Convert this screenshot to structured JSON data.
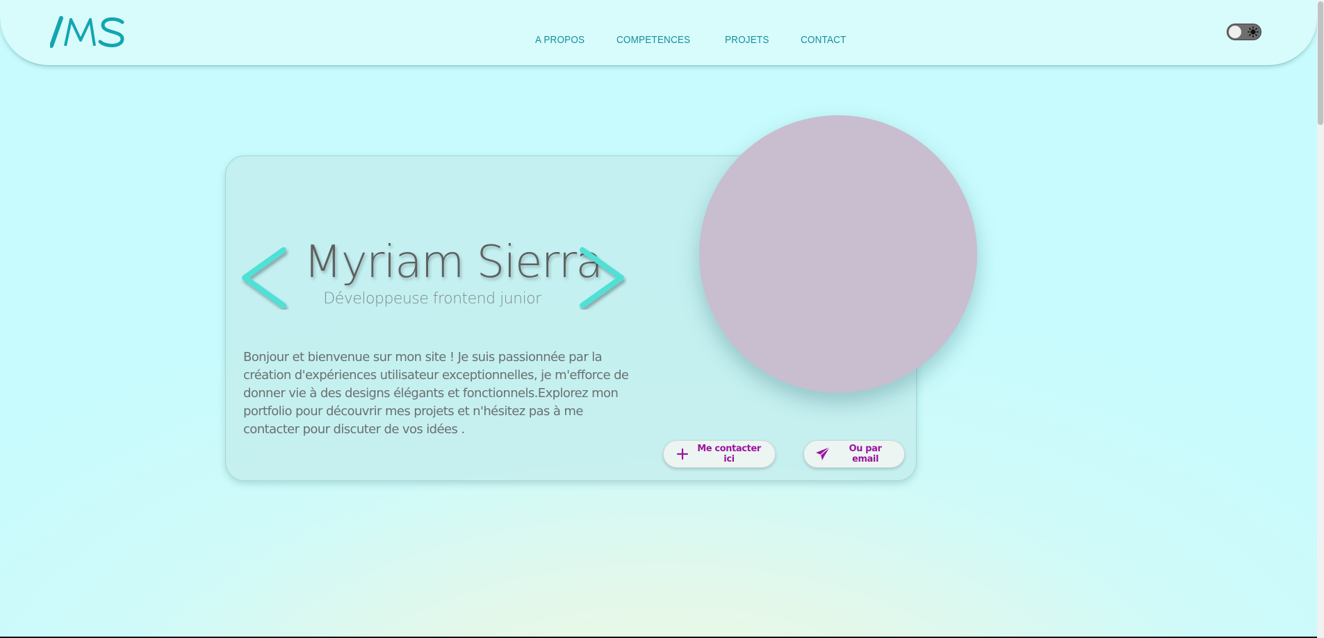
{
  "header": {
    "logo_text": "/MS",
    "nav": [
      "A PROPOS",
      "COMPETENCES",
      "PROJETS",
      "CONTACT"
    ],
    "theme_toggle": {
      "state": "off",
      "icon": "sun-icon"
    }
  },
  "hero": {
    "name": "Myriam Sierra",
    "role": "Développeuse frontend junior",
    "intro": "Bonjour et bienvenue sur mon site ! Je suis passionnée par la création d'expériences utilisateur exceptionnelles, je m'efforce de donner vie à des designs élégants et fonctionnels.Explorez mon portfolio pour découvrir mes projets et n'hésitez pas à me contacter pour discuter de vos idées .",
    "buttons": {
      "contact_label": "Me contacter ici",
      "email_label": "Ou par email"
    }
  },
  "colors": {
    "accent": "#12909a",
    "bracket": "#4fe0d6",
    "button_text": "#9b15a0",
    "avatar_placeholder": "#c8becf"
  }
}
